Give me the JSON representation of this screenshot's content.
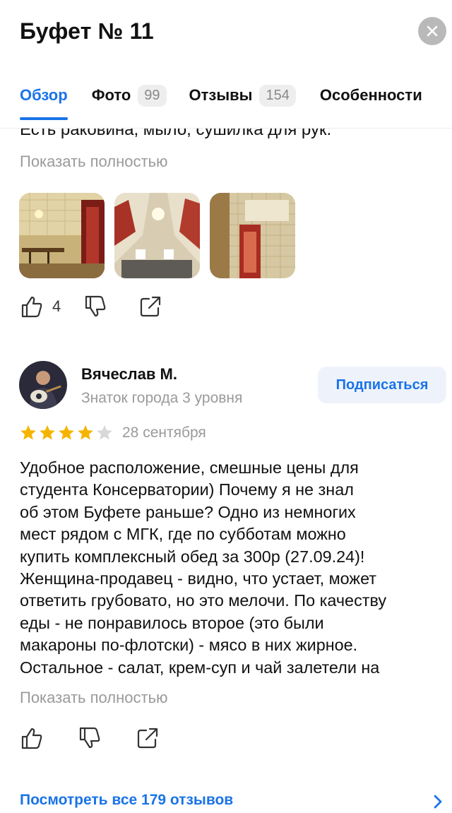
{
  "header": {
    "title": "Буфет № 11",
    "close_icon": "close-icon"
  },
  "tabs": [
    {
      "label": "Обзор",
      "count": null,
      "active": true
    },
    {
      "label": "Фото",
      "count": "99",
      "active": false
    },
    {
      "label": "Отзывы",
      "count": "154",
      "active": false
    },
    {
      "label": "Особенности",
      "count": null,
      "active": false
    }
  ],
  "prev_review": {
    "text_tail": "Есть раковина, мыло, сушилка для рук.",
    "show_more": "Показать полностью",
    "likes": "4",
    "photos": [
      "interior-bar-photo",
      "interior-ceiling-photo",
      "entrance-sign-photo"
    ]
  },
  "review": {
    "author": "Вячеслав М.",
    "level": "Знаток города 3 уровня",
    "subscribe_label": "Подписаться",
    "rating": 4,
    "rating_max": 5,
    "date": "28 сентября",
    "text": "Удобное расположение, смешные цены для\nстудента Консерватории) Почему я не знал\nоб этом Буфете раньше? Одно из немногих\nмест рядом с МГК, где по субботам можно\nкупить комплексный обед за 300р (27.09.24)!\nЖенщина-продавец - видно, что устает, может\nответить грубовато, но это мелочи. По качеству\nеды - не понравилось второе (это были\nмакароны по-флотски) - мясо в них жирное.\nОстальное - салат, крем-суп и чай залетели на",
    "show_more": "Показать полностью"
  },
  "footer": {
    "all_reviews_label": "Посмотреть все 179 отзывов"
  },
  "colors": {
    "accent": "#1a73e8",
    "star": "#f5b400",
    "star_empty": "#d8d8d8",
    "muted": "#9a9a9a"
  }
}
